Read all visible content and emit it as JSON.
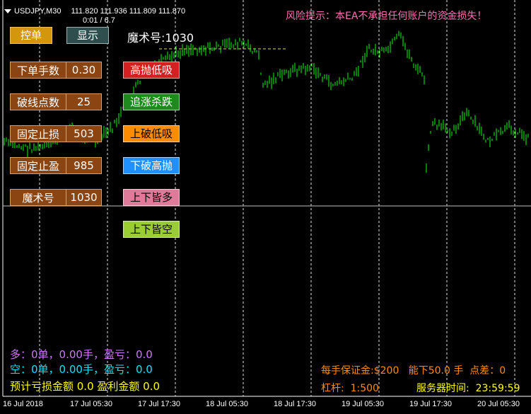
{
  "header": {
    "symbol_tf": "USDJPY,M30",
    "ohlc": "111.820 111.936 111.809 111.870",
    "counter": "0:01 / 6.7"
  },
  "risk_warning": "风险提示：本EA不承担任何账户的资金损失！",
  "top_buttons": {
    "control_label": "控单",
    "show_label": "显示",
    "magic_label": "魔术号:1030"
  },
  "params": [
    {
      "label": "下单手数",
      "value": "0.30"
    },
    {
      "label": "破线点数",
      "value": "25"
    },
    {
      "label": "固定止损",
      "value": "503"
    },
    {
      "label": "固定止盈",
      "value": "985"
    },
    {
      "label": "魔术号",
      "value": "1030"
    }
  ],
  "strategies": [
    {
      "label": "高抛低吸",
      "bg": "#d42020",
      "fg": "#ffffff"
    },
    {
      "label": "追涨杀跌",
      "bg": "#1e8a1e",
      "fg": "#ffffff"
    },
    {
      "label": "上破低吸",
      "bg": "#ff8c00",
      "fg": "#000000"
    },
    {
      "label": "下破高抛",
      "bg": "#1e90ff",
      "fg": "#ffffff"
    },
    {
      "label": "上下皆多",
      "bg": "#e07a9a",
      "fg": "#000000"
    },
    {
      "label": "上下皆空",
      "bg": "#9acd32",
      "fg": "#000000"
    }
  ],
  "status": {
    "long_line": "多：0单，0.00手，盈亏：0.0",
    "short_line": "空：0单，0.00手，盈亏：0.0",
    "estimate_line": "预计亏损金额 0.0 盈利金额 0.0",
    "margin_line": "每手保证金:$200   能下50.0 手  点差：0",
    "leverage_line": "杠杆:  1:500",
    "server_time_line": "服务器时间:  23:59:59"
  },
  "colors": {
    "long": "#cc77ff",
    "short": "#00e5ff",
    "estimate": "#ffff00",
    "account": "#ff8c00",
    "server": "#ffff00",
    "risk": "#ff6eb4",
    "candle": "#00ff00"
  },
  "x_axis_labels": [
    "16 Jul 2018",
    "17 Jul 05:30",
    "17 Jul 17:30",
    "18 Jul 05:30",
    "18 Jul 17:30",
    "19 Jul 05:30",
    "19 Jul 17:30",
    "20 Jul 05:30"
  ]
}
